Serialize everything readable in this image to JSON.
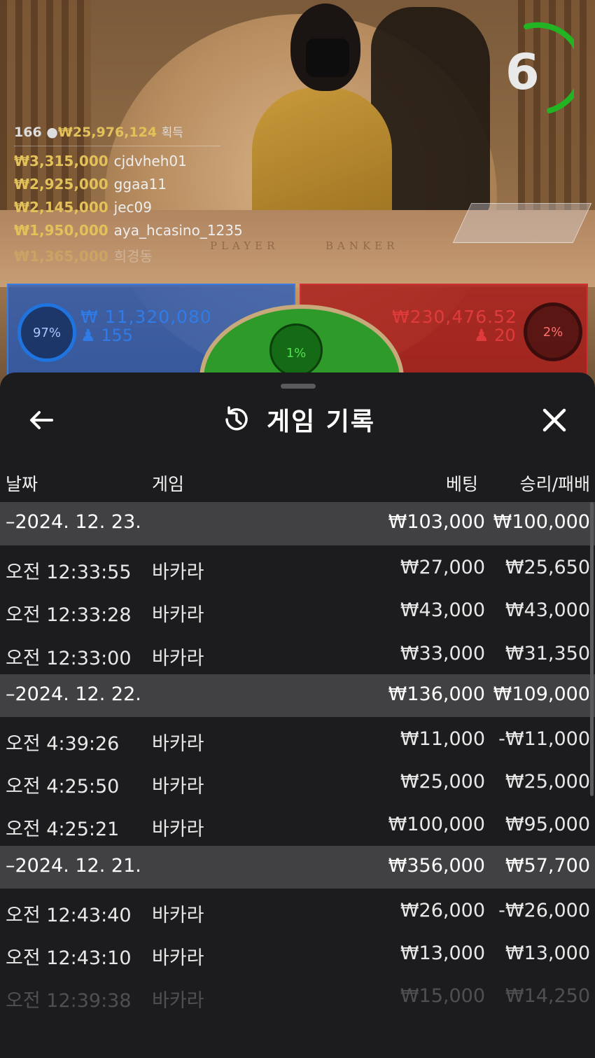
{
  "video": {
    "timer": "6",
    "table_labels": {
      "player": "PLAYER",
      "banker": "BANKER"
    },
    "leaderboard": {
      "count": "166",
      "total": "₩25,976,124",
      "earned_label": "획득",
      "entries": [
        {
          "amount": "₩3,315,000",
          "name": "cjdvheh01"
        },
        {
          "amount": "₩2,925,000",
          "name": "ggaa11"
        },
        {
          "amount": "₩2,145,000",
          "name": "jec09"
        },
        {
          "amount": "₩1,950,000",
          "name": "aya_hcasino_1235"
        },
        {
          "amount": "₩1,365,000",
          "name": "희경동"
        }
      ]
    },
    "player_bet": {
      "percent": "97%",
      "amount": "₩ 11,320,080",
      "count": "155"
    },
    "banker_bet": {
      "percent": "2%",
      "amount": "₩230,476.52",
      "count": "20"
    },
    "tie_bet": {
      "percent": "1%"
    },
    "colors": {
      "player": "#2f7ce8",
      "banker": "#e03b3b",
      "tie": "#2e9a2a",
      "gold": "#e2c15a"
    }
  },
  "sheet": {
    "title": "게임 기록",
    "icons": {
      "back": "arrow-left-icon",
      "history": "history-icon",
      "close": "close-icon"
    },
    "columns": {
      "date": "날짜",
      "game": "게임",
      "bet": "베팅",
      "result": "승리/패배"
    },
    "days": [
      {
        "date": "–2024. 12. 23.",
        "bet": "₩103,000",
        "result": "₩100,000",
        "games": [
          {
            "time": "오전 12:33:55",
            "game": "바카라",
            "bet": "₩27,000",
            "result": "₩25,650"
          },
          {
            "time": "오전 12:33:28",
            "game": "바카라",
            "bet": "₩43,000",
            "result": "₩43,000"
          },
          {
            "time": "오전 12:33:00",
            "game": "바카라",
            "bet": "₩33,000",
            "result": "₩31,350"
          }
        ]
      },
      {
        "date": "–2024. 12. 22.",
        "bet": "₩136,000",
        "result": "₩109,000",
        "games": [
          {
            "time": "오전 4:39:26",
            "game": "바카라",
            "bet": "₩11,000",
            "result": "-₩11,000"
          },
          {
            "time": "오전 4:25:50",
            "game": "바카라",
            "bet": "₩25,000",
            "result": "₩25,000"
          },
          {
            "time": "오전 4:25:21",
            "game": "바카라",
            "bet": "₩100,000",
            "result": "₩95,000"
          }
        ]
      },
      {
        "date": "–2024. 12. 21.",
        "bet": "₩356,000",
        "result": "₩57,700",
        "games": [
          {
            "time": "오전 12:43:40",
            "game": "바카라",
            "bet": "₩26,000",
            "result": "-₩26,000"
          },
          {
            "time": "오전 12:43:10",
            "game": "바카라",
            "bet": "₩13,000",
            "result": "₩13,000"
          },
          {
            "time": "오전 12:39:38",
            "game": "바카라",
            "bet": "₩15,000",
            "result": "₩14,250"
          }
        ]
      }
    ]
  }
}
